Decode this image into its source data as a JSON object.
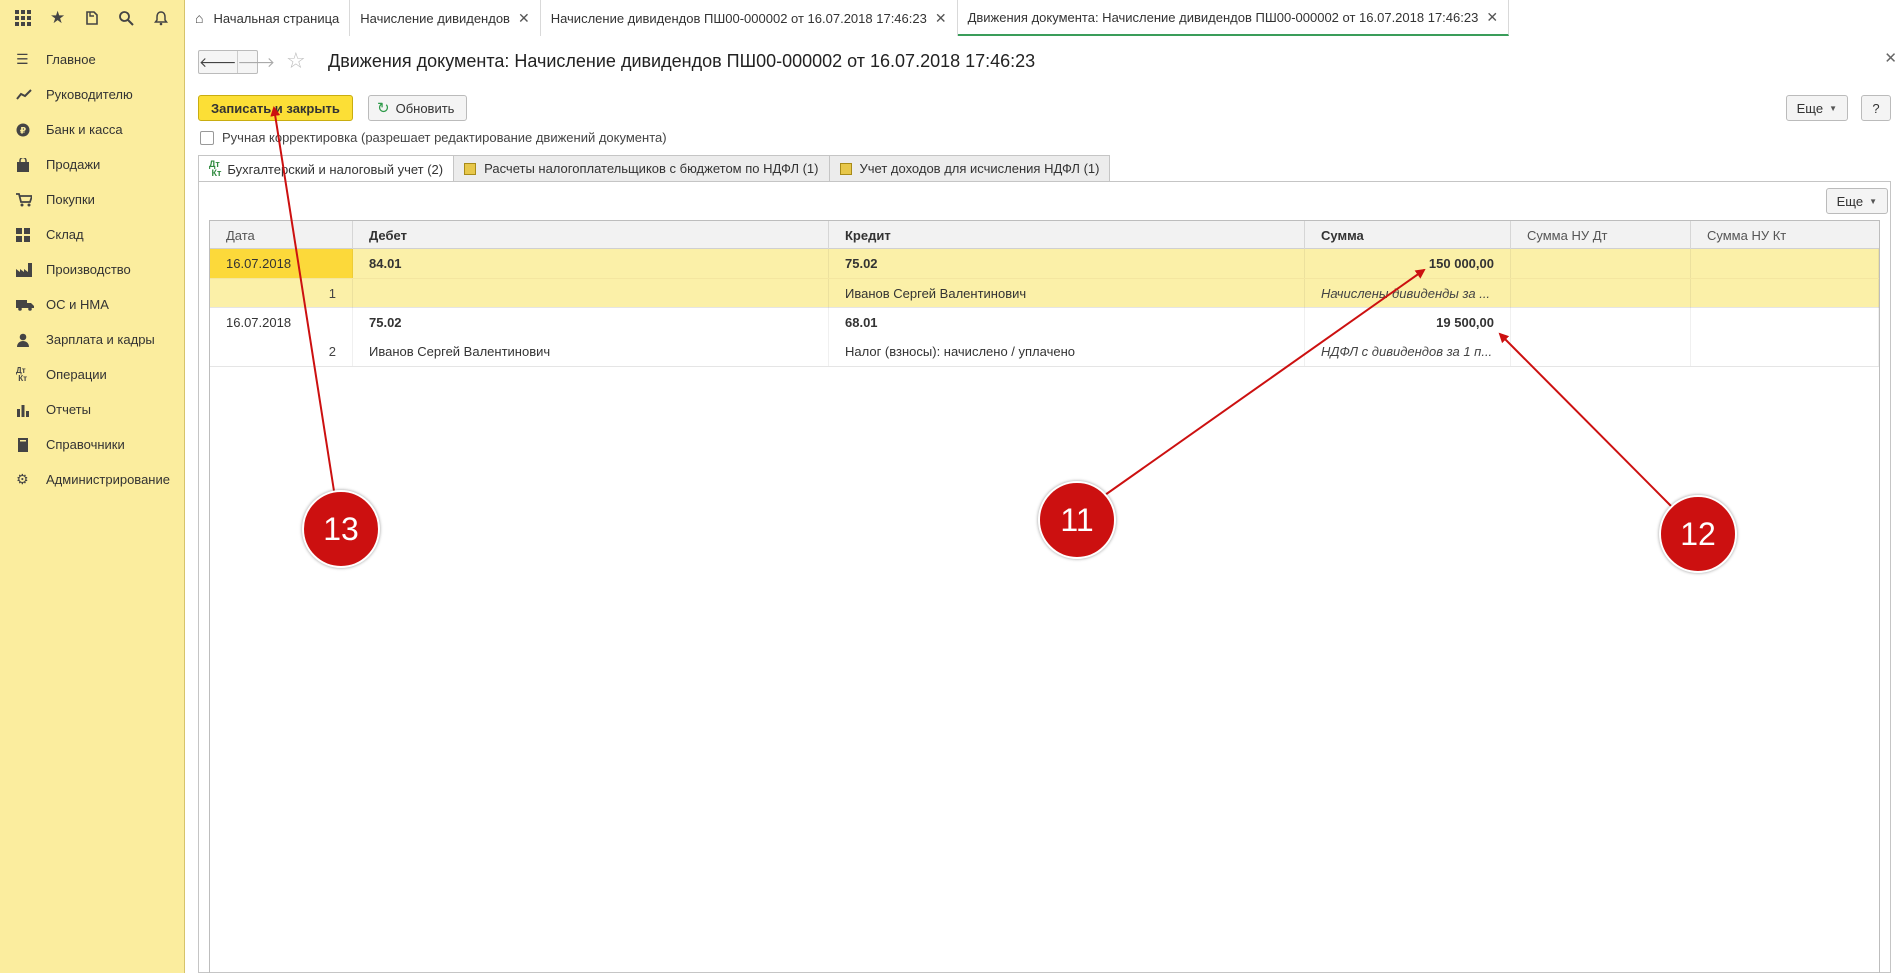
{
  "topbar": {
    "icons": [
      "apps-grid-icon",
      "star-icon",
      "history-icon",
      "search-icon",
      "bell-icon"
    ],
    "tabs": [
      {
        "label": "Начальная страница",
        "closable": false
      },
      {
        "label": "Начисление дивидендов",
        "closable": true
      },
      {
        "label": "Начисление дивидендов ПШ00-000002 от 16.07.2018 17:46:23",
        "closable": true
      },
      {
        "label": "Движения документа: Начисление дивидендов ПШ00-000002 от 16.07.2018 17:46:23",
        "closable": true,
        "active": true
      }
    ]
  },
  "sidebar": {
    "items": [
      {
        "label": "Главное",
        "icon": "menu-lines-icon"
      },
      {
        "label": "Руководителю",
        "icon": "trend-icon"
      },
      {
        "label": "Банк и касса",
        "icon": "ruble-coin-icon"
      },
      {
        "label": "Продажи",
        "icon": "shopping-bag-icon"
      },
      {
        "label": "Покупки",
        "icon": "cart-icon"
      },
      {
        "label": "Склад",
        "icon": "warehouse-icon"
      },
      {
        "label": "Производство",
        "icon": "factory-icon"
      },
      {
        "label": "ОС и НМА",
        "icon": "truck-icon"
      },
      {
        "label": "Зарплата и кадры",
        "icon": "person-icon"
      },
      {
        "label": "Операции",
        "icon": "dt-kt-icon"
      },
      {
        "label": "Отчеты",
        "icon": "bar-chart-icon"
      },
      {
        "label": "Справочники",
        "icon": "book-icon"
      },
      {
        "label": "Администрирование",
        "icon": "gear-icon"
      }
    ]
  },
  "page": {
    "title": "Движения документа: Начисление дивидендов ПШ00-000002 от 16.07.2018 17:46:23",
    "save_close": "Записать и закрыть",
    "refresh": "Обновить",
    "more": "Еще",
    "help": "?",
    "manual_label": "Ручная корректировка (разрешает редактирование движений документа)",
    "manual_checked": false,
    "subtabs": [
      {
        "label": "Бухгалтерский и налоговый учет (2)",
        "icon": "dt-kt-icon",
        "active": true
      },
      {
        "label": "Расчеты налогоплательщиков с бюджетом по НДФЛ (1)",
        "icon": "register-icon"
      },
      {
        "label": "Учет доходов для исчисления НДФЛ (1)",
        "icon": "register-icon"
      }
    ],
    "grid_more": "Еще"
  },
  "grid": {
    "columns": {
      "date": "Дата",
      "debit": "Дебет",
      "credit": "Кредит",
      "sum": "Сумма",
      "sum_nu_dt": "Сумма НУ Дт",
      "sum_nu_kt": "Сумма НУ Кт"
    },
    "rows": [
      {
        "date": "16.07.2018",
        "num": "1",
        "debit": "84.01",
        "debit_sub": "",
        "credit": "75.02",
        "credit_sub": "Иванов Сергей Валентинович",
        "sum": "150 000,00",
        "comment": "Начислены дивиденды за ...",
        "selected": true
      },
      {
        "date": "16.07.2018",
        "num": "2",
        "debit": "75.02",
        "debit_sub": "Иванов Сергей Валентинович",
        "credit": "68.01",
        "credit_sub": "Налог (взносы): начислено / уплачено",
        "sum": "19 500,00",
        "comment": "НДФЛ с дивидендов за 1 п...",
        "selected": false
      }
    ]
  },
  "annotations": {
    "callouts": [
      "13",
      "11",
      "12"
    ],
    "color": "#cc1010"
  }
}
